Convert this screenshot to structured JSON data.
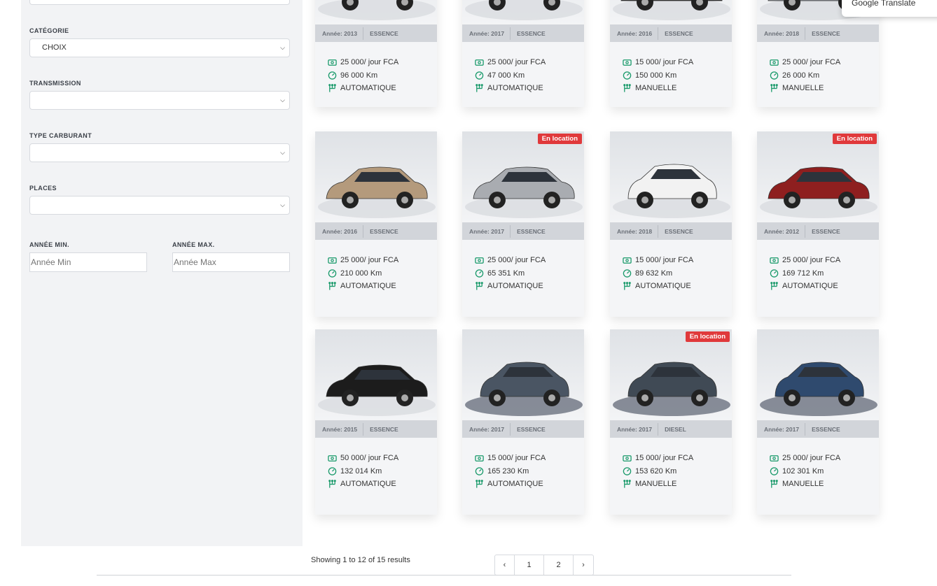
{
  "filters": {
    "categorie": {
      "label": "CATÉGORIE",
      "value": "CHOIX"
    },
    "transmission": {
      "label": "TRANSMISSION",
      "value": ""
    },
    "carburant": {
      "label": "TYPE CARBURANT",
      "value": ""
    },
    "places": {
      "label": "PLACES",
      "value": ""
    },
    "annee_min": {
      "label": "ANNÉE MIN.",
      "placeholder": "Année Min"
    },
    "annee_max": {
      "label": "ANNÉE MAX.",
      "placeholder": "Année Max"
    }
  },
  "google_translate": "Google Translate",
  "cars": [
    {
      "year": "Année: 2013",
      "fuel": "ESSENCE",
      "price": "25 000/ jour FCA",
      "km": "96 000 Km",
      "gearbox": "AUTOMATIQUE",
      "badge": "",
      "body": "suv",
      "color": "#e8e8e8"
    },
    {
      "year": "Année: 2017",
      "fuel": "ESSENCE",
      "price": "25 000/ jour FCA",
      "km": "47 000 Km",
      "gearbox": "AUTOMATIQUE",
      "badge": "",
      "body": "suv",
      "color": "#f0f0f0"
    },
    {
      "year": "Année: 2016",
      "fuel": "ESSENCE",
      "price": "15 000/ jour FCA",
      "km": "150 000 Km",
      "gearbox": "MANUELLE",
      "badge": "",
      "body": "sedan",
      "color": "#2a2a2a"
    },
    {
      "year": "Année: 2018",
      "fuel": "ESSENCE",
      "price": "25 000/ jour FCA",
      "km": "26 000 Km",
      "gearbox": "MANUELLE",
      "badge": "",
      "body": "sedan",
      "color": "#8a8f95"
    },
    {
      "year": "Année: 2016",
      "fuel": "ESSENCE",
      "price": "25 000/ jour FCA",
      "km": "210 000 Km",
      "gearbox": "AUTOMATIQUE",
      "badge": "",
      "body": "sedan",
      "color": "#b49a7c"
    },
    {
      "year": "Année: 2017",
      "fuel": "ESSENCE",
      "price": "25 000/ jour FCA",
      "km": "65 351 Km",
      "gearbox": "AUTOMATIQUE",
      "badge": "En location",
      "body": "sedan",
      "color": "#a9acb1"
    },
    {
      "year": "Année: 2018",
      "fuel": "ESSENCE",
      "price": "15 000/ jour FCA",
      "km": "89 632 Km",
      "gearbox": "AUTOMATIQUE",
      "badge": "",
      "body": "hatch",
      "color": "#f2f2f2"
    },
    {
      "year": "Année: 2012",
      "fuel": "ESSENCE",
      "price": "25 000/ jour FCA",
      "km": "169 712 Km",
      "gearbox": "AUTOMATIQUE",
      "badge": "En location",
      "body": "sedan",
      "color": "#8e1f1f"
    },
    {
      "year": "Année: 2015",
      "fuel": "ESSENCE",
      "price": "50 000/ jour FCA",
      "km": "132 014 Km",
      "gearbox": "AUTOMATIQUE",
      "badge": "",
      "body": "sedan",
      "color": "#1c1c1c"
    },
    {
      "year": "Année: 2017",
      "fuel": "ESSENCE",
      "price": "15 000/ jour FCA",
      "km": "165 230 Km",
      "gearbox": "AUTOMATIQUE",
      "badge": "",
      "body": "hatch",
      "color": "#4a5563"
    },
    {
      "year": "Année: 2017",
      "fuel": "DIESEL",
      "price": "15 000/ jour FCA",
      "km": "153 620 Km",
      "gearbox": "MANUELLE",
      "badge": "En location",
      "body": "hatch",
      "color": "#404a55"
    },
    {
      "year": "Année: 2017",
      "fuel": "ESSENCE",
      "price": "25 000/ jour FCA",
      "km": "102 301 Km",
      "gearbox": "MANUELLE",
      "badge": "",
      "body": "hatch",
      "color": "#2f4a6e"
    }
  ],
  "pagination": {
    "summary": "Showing 1 to 12 of 15 results",
    "prev": "‹",
    "page1": "1",
    "page2": "2",
    "next": "›"
  },
  "colors": {
    "accent": "#1a9a6b",
    "badge": "#e0393b"
  }
}
